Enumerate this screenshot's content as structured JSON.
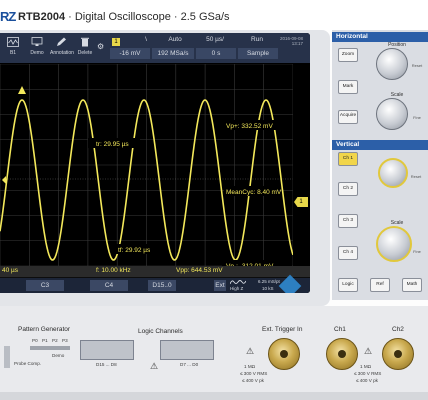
{
  "header": {
    "brand": "RZ",
    "model": "RTB2004",
    "subtitle": "· Digital Oscilloscope · 2.5 GSa/s"
  },
  "toolbar": {
    "buttons": [
      {
        "label": "B1",
        "icon": "waveform-icon"
      },
      {
        "label": "Demo",
        "icon": "monitor-icon"
      },
      {
        "label": "Annotation",
        "icon": "pen-icon"
      },
      {
        "label": "Delete",
        "icon": "trash-icon"
      }
    ],
    "trigger_channel": "1",
    "trigger_slope": "\\",
    "trigger_mode": "Auto",
    "timebase": "50 µs/",
    "run_state": "Run",
    "trigger_level": "-16 mV",
    "sample_rate": "192 MSa/s",
    "offset": "0 s",
    "acq_mode": "Sample",
    "date": "2016-09-08",
    "time": "13:17"
  },
  "measurements": {
    "vp_plus": "Vp+: 332.52 mV",
    "mean_cyc": "MeanCyc: 8.40 mV",
    "vp_minus": "Vp-: -312.01 mV",
    "tr": "tr: 29.95 µs",
    "tf": "tf: 29.92 µs"
  },
  "channel_marker": "1",
  "status": {
    "left": "40 µs",
    "freq": "f: 10.00 kHz",
    "vpp": "Vpp: 644.53 mV",
    "tabs": [
      "C3",
      "C4",
      "D15..0"
    ],
    "mode": "High Z",
    "rec_label": "6.25 mS/pt",
    "rec_value": "10 kS"
  },
  "panel": {
    "horizontal": "Horizontal",
    "zoom": "Zoom",
    "mark": "Mark",
    "acquire": "Acquire",
    "position_label": "Position",
    "scale_label": "Scale",
    "vertical": "Vertical",
    "ch1": "Ch 1",
    "ch2": "Ch 2",
    "ch3": "Ch 3",
    "ch4": "Ch 4",
    "logic": "Logic",
    "ref": "Ref",
    "math": "Math",
    "fine_hint": "Fine",
    "reset_hint": "Reset"
  },
  "front": {
    "pattern_generator": "Pattern Generator",
    "pins": [
      "P0",
      "P1",
      "P2",
      "P3"
    ],
    "demo": "Demo",
    "probe_comp": "Probe Comp.",
    "logic_channels": "Logic Channels",
    "d15": "D15 ... D8",
    "d7": "D7 ... D0",
    "ext_trigger": "Ext. Trigger In",
    "ch1": "Ch1",
    "ch2": "Ch2",
    "rating": "1 MΩ",
    "rating2": "≤ 300 V RMS",
    "rating3": "≤ 400 V pk"
  }
}
